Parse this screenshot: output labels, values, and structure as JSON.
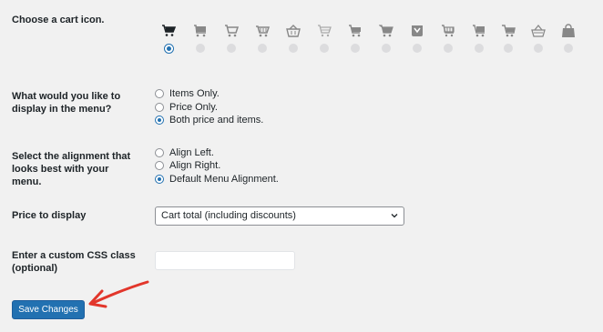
{
  "cart_icon": {
    "label": "Choose a cart icon.",
    "options": [
      {
        "icon": "cart-solid-icon",
        "selected": true
      },
      {
        "icon": "cart-flat-icon",
        "selected": false
      },
      {
        "icon": "cart-outline-icon",
        "selected": false
      },
      {
        "icon": "cart-basket-icon",
        "selected": false
      },
      {
        "icon": "basket-handle-icon",
        "selected": false
      },
      {
        "icon": "cart-wire-icon",
        "selected": false
      },
      {
        "icon": "cart-flat-alt-icon",
        "selected": false
      },
      {
        "icon": "cart-solid-alt-icon",
        "selected": false
      },
      {
        "icon": "shopping-bag-v-icon",
        "selected": false
      },
      {
        "icon": "cart-grid-icon",
        "selected": false
      },
      {
        "icon": "cart-box-icon",
        "selected": false
      },
      {
        "icon": "cart-trolley-icon",
        "selected": false
      },
      {
        "icon": "basket-round-icon",
        "selected": false
      },
      {
        "icon": "shopping-bag-icon",
        "selected": false
      }
    ]
  },
  "display": {
    "label": "What would you like to display in the menu?",
    "options": [
      "Items Only.",
      "Price Only.",
      "Both price and items."
    ],
    "selected_index": 2
  },
  "alignment": {
    "label": "Select the alignment that looks best with your menu.",
    "options": [
      "Align Left.",
      "Align Right.",
      "Default Menu Alignment."
    ],
    "selected_index": 2
  },
  "price": {
    "label": "Price to display",
    "selected": "Cart total (including discounts)"
  },
  "css_class": {
    "label": "Enter a custom CSS class (optional)",
    "value": ""
  },
  "save_label": "Save Changes",
  "colors": {
    "accent": "#2271b1",
    "arrow": "#e2362b"
  }
}
